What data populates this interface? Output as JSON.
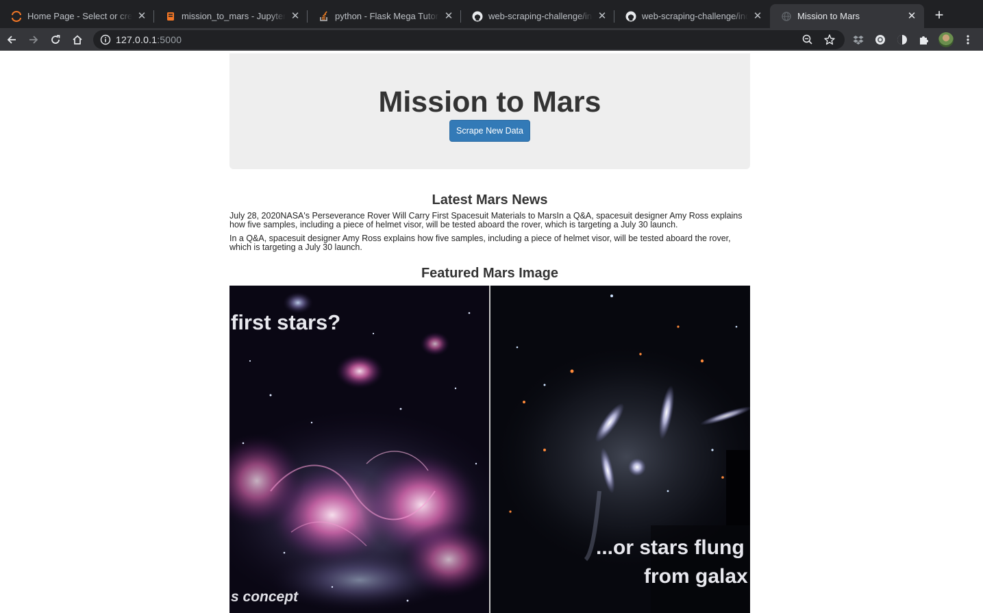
{
  "browser": {
    "tabs": [
      {
        "label": "Home Page - Select or create a notebook",
        "icon": "jupyter-logo-icon",
        "active": false
      },
      {
        "label": "mission_to_mars - Jupyter Notebook",
        "icon": "notebook-icon",
        "active": false
      },
      {
        "label": "python - Flask Mega Tutorial",
        "icon": "stackoverflow-icon",
        "active": false
      },
      {
        "label": "web-scraping-challenge/index.html",
        "icon": "github-icon",
        "active": false
      },
      {
        "label": "web-scraping-challenge/index.html",
        "icon": "github-icon",
        "active": false
      },
      {
        "label": "Mission to Mars",
        "icon": "globe-icon",
        "active": true
      }
    ],
    "url_host": "127.0.0.1",
    "url_port": ":5000"
  },
  "page": {
    "title": "Mission to Mars",
    "scrape_button": "Scrape New Data",
    "news_heading": "Latest Mars News",
    "news_title_line": "July 28, 2020NASA's Perseverance Rover Will Carry First Spacesuit Materials to MarsIn a Q&A, spacesuit designer Amy Ross explains how five samples, including a piece of helmet visor, will be tested aboard the rover, which is targeting a July 30 launch.",
    "news_paragraph": "In a Q&A, spacesuit designer Amy Ross explains how five samples, including a piece of helmet visor, will be tested aboard the rover, which is targeting a July 30 launch.",
    "featured_heading": "Featured Mars Image",
    "featured_image_text": {
      "left_top": "first stars?",
      "left_bottom": "s concept",
      "right_line1": "...or stars flung",
      "right_line2": "from galax"
    }
  },
  "colors": {
    "tabstrip": "#202124",
    "toolbar": "#35363a",
    "jumbotron": "#eeeeee",
    "button": "#337ab7"
  }
}
